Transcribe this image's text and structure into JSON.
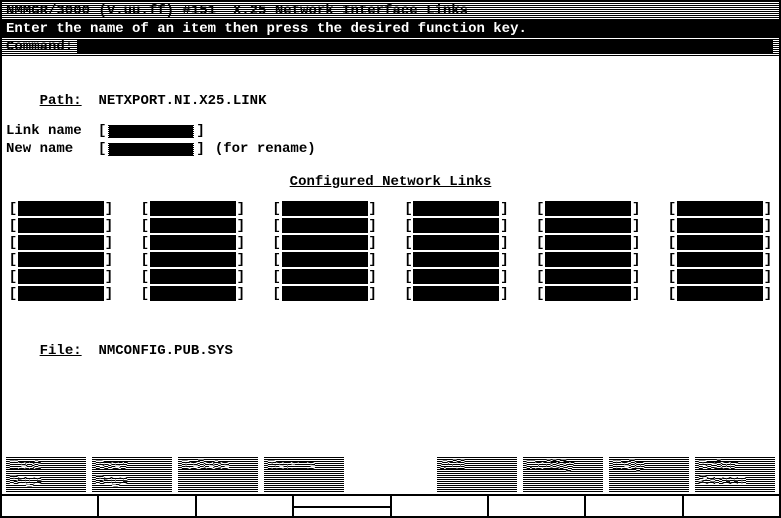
{
  "title": "NMMGR/3000 (V.uu.ff) #151  X.25 Network Interface Links",
  "instruction": "Enter the name of an item then press the desired function key.",
  "command_label": "Command:",
  "path_label": "Path:",
  "path_value": "NETXPORT.NI.X25.LINK",
  "link_name_label": "Link name",
  "new_name_label": "New name",
  "rename_hint": "(for rename)",
  "section_title": "Configured Network Links",
  "file_label": "File:",
  "file_value": "NMCONFIG.PUB.SYS",
  "fkeys": {
    "f1a": "Next",
    "f1b": "Page",
    "f2a": "Prev",
    "f2b": "Page",
    "f3a": "Delete",
    "f4a": "Rename",
    "f5a": "Add",
    "f6a": "Modify",
    "f7a": "Help",
    "f8a": "Prior",
    "f8b": "Screen"
  }
}
